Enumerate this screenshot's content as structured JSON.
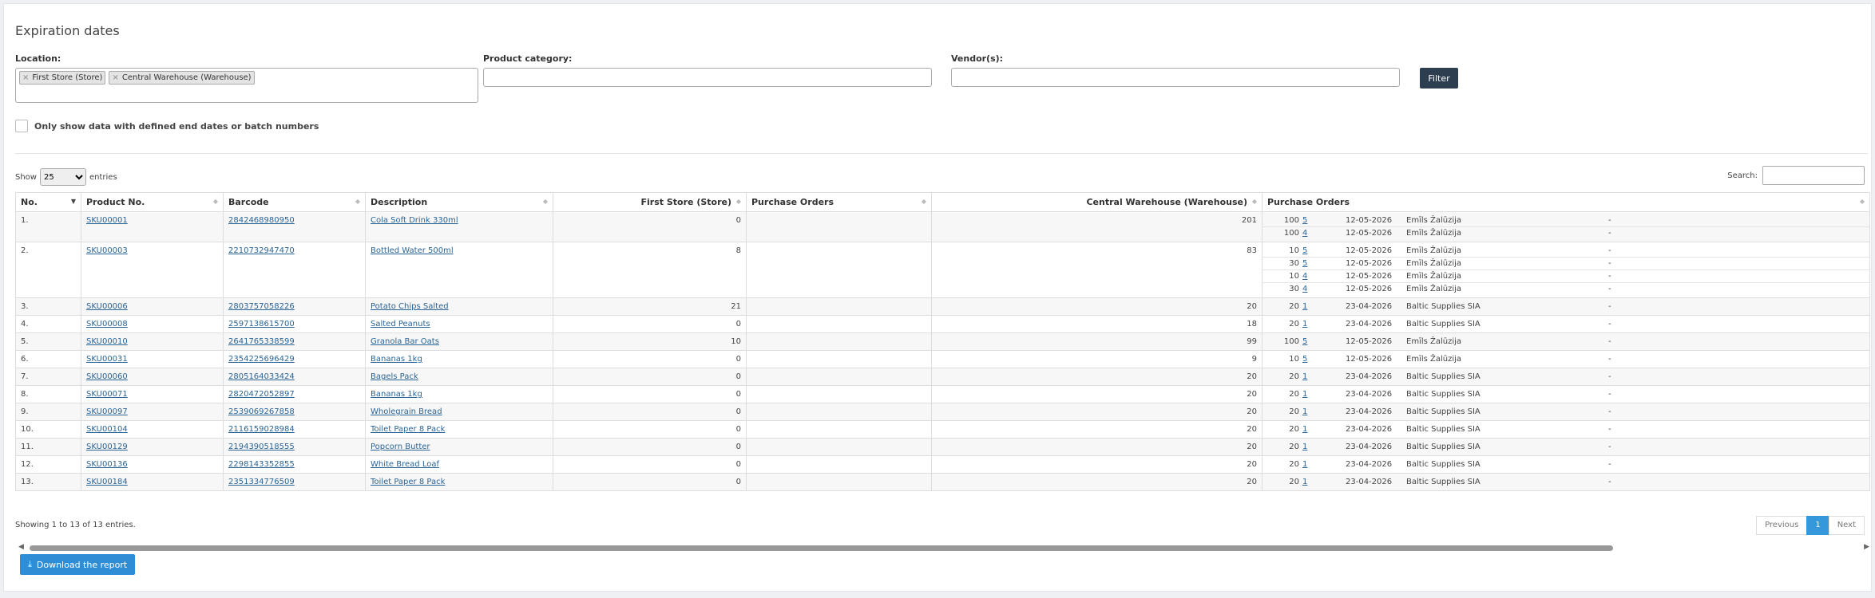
{
  "page_title": "Expiration dates",
  "filters": {
    "location_label": "Location:",
    "location_tags": [
      "First Store (Store)",
      "Central Warehouse (Warehouse)"
    ],
    "tag_remove": "×",
    "category_label": "Product category:",
    "vendor_label": "Vendor(s):",
    "filter_button": "Filter",
    "checkbox_label": "Only show data with defined end dates or batch numbers"
  },
  "table_controls": {
    "show_label": "Show",
    "entries_value": "25",
    "entries_label": "entries",
    "search_label": "Search:"
  },
  "columns": [
    "No.",
    "Product No.",
    "Barcode",
    "Description",
    "First Store (Store)",
    "Purchase Orders",
    "Central Warehouse (Warehouse)",
    "Purchase Orders"
  ],
  "rows": [
    {
      "no": "1.",
      "sku": "SKU00001",
      "barcode": "2842468980950",
      "desc": "Cola Soft Drink 330ml",
      "store": "0",
      "warehouse": "201",
      "po": [
        [
          "100",
          "5",
          "12-05-2026",
          "Emīls Žalūzija",
          "-"
        ],
        [
          "100",
          "4",
          "12-05-2026",
          "Emīls Žalūzija",
          "-"
        ]
      ]
    },
    {
      "no": "2.",
      "sku": "SKU00003",
      "barcode": "2210732947470",
      "desc": "Bottled Water 500ml",
      "store": "8",
      "warehouse": "83",
      "po": [
        [
          "10",
          "5",
          "12-05-2026",
          "Emīls Žalūzija",
          "-"
        ],
        [
          "30",
          "5",
          "12-05-2026",
          "Emīls Žalūzija",
          "-"
        ],
        [
          "10",
          "4",
          "12-05-2026",
          "Emīls Žalūzija",
          "-"
        ],
        [
          "30",
          "4",
          "12-05-2026",
          "Emīls Žalūzija",
          "-"
        ]
      ]
    },
    {
      "no": "3.",
      "sku": "SKU00006",
      "barcode": "2803757058226",
      "desc": "Potato Chips Salted",
      "store": "21",
      "warehouse": "20",
      "po": [
        [
          "20",
          "1",
          "23-04-2026",
          "Baltic Supplies SIA",
          "-"
        ]
      ]
    },
    {
      "no": "4.",
      "sku": "SKU00008",
      "barcode": "2597138615700",
      "desc": "Salted Peanuts",
      "store": "0",
      "warehouse": "18",
      "po": [
        [
          "20",
          "1",
          "23-04-2026",
          "Baltic Supplies SIA",
          "-"
        ]
      ]
    },
    {
      "no": "5.",
      "sku": "SKU00010",
      "barcode": "2641765338599",
      "desc": "Granola Bar Oats",
      "store": "10",
      "warehouse": "99",
      "po": [
        [
          "100",
          "5",
          "12-05-2026",
          "Emīls Žalūzija",
          "-"
        ]
      ]
    },
    {
      "no": "6.",
      "sku": "SKU00031",
      "barcode": "2354225696429",
      "desc": "Bananas 1kg",
      "store": "0",
      "warehouse": "9",
      "po": [
        [
          "10",
          "5",
          "12-05-2026",
          "Emīls Žalūzija",
          "-"
        ]
      ]
    },
    {
      "no": "7.",
      "sku": "SKU00060",
      "barcode": "2805164033424",
      "desc": "Bagels Pack",
      "store": "0",
      "warehouse": "20",
      "po": [
        [
          "20",
          "1",
          "23-04-2026",
          "Baltic Supplies SIA",
          "-"
        ]
      ]
    },
    {
      "no": "8.",
      "sku": "SKU00071",
      "barcode": "2820472052897",
      "desc": "Bananas 1kg",
      "store": "0",
      "warehouse": "20",
      "po": [
        [
          "20",
          "1",
          "23-04-2026",
          "Baltic Supplies SIA",
          "-"
        ]
      ]
    },
    {
      "no": "9.",
      "sku": "SKU00097",
      "barcode": "2539069267858",
      "desc": "Wholegrain Bread",
      "store": "0",
      "warehouse": "20",
      "po": [
        [
          "20",
          "1",
          "23-04-2026",
          "Baltic Supplies SIA",
          "-"
        ]
      ]
    },
    {
      "no": "10.",
      "sku": "SKU00104",
      "barcode": "2116159028984",
      "desc": "Toilet Paper 8 Pack",
      "store": "0",
      "warehouse": "20",
      "po": [
        [
          "20",
          "1",
          "23-04-2026",
          "Baltic Supplies SIA",
          "-"
        ]
      ]
    },
    {
      "no": "11.",
      "sku": "SKU00129",
      "barcode": "2194390518555",
      "desc": "Popcorn Butter",
      "store": "0",
      "warehouse": "20",
      "po": [
        [
          "20",
          "1",
          "23-04-2026",
          "Baltic Supplies SIA",
          "-"
        ]
      ]
    },
    {
      "no": "12.",
      "sku": "SKU00136",
      "barcode": "2298143352855",
      "desc": "White Bread Loaf",
      "store": "0",
      "warehouse": "20",
      "po": [
        [
          "20",
          "1",
          "23-04-2026",
          "Baltic Supplies SIA",
          "-"
        ]
      ]
    },
    {
      "no": "13.",
      "sku": "SKU00184",
      "barcode": "2351334776509",
      "desc": "Toilet Paper 8 Pack",
      "store": "0",
      "warehouse": "20",
      "po": [
        [
          "20",
          "1",
          "23-04-2026",
          "Baltic Supplies SIA",
          "-"
        ]
      ]
    }
  ],
  "footer": {
    "info": "Showing 1 to 13 of 13 entries.",
    "prev": "Previous",
    "page": "1",
    "next": "Next",
    "download": "Download the report"
  }
}
